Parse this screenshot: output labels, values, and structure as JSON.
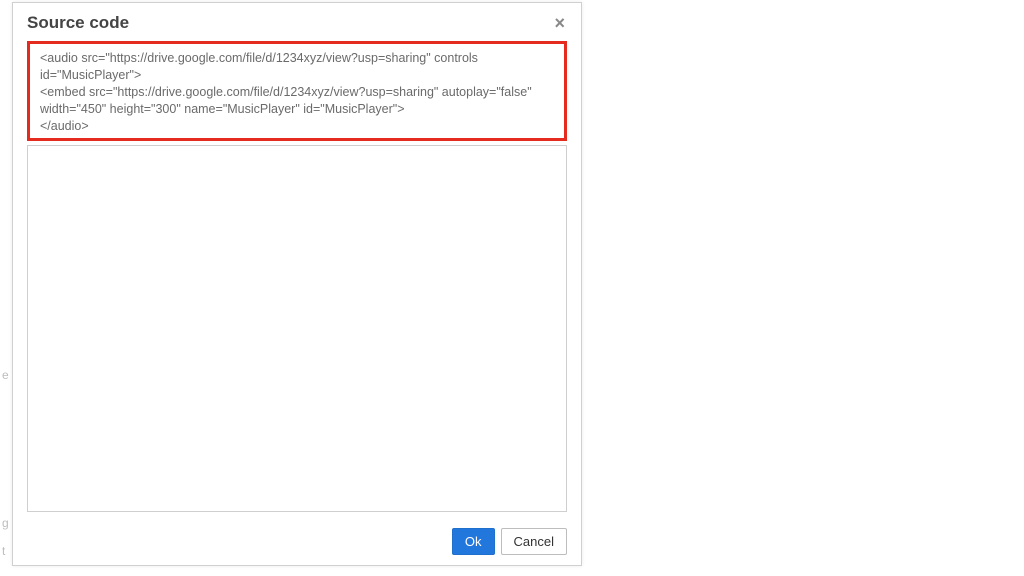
{
  "dialog": {
    "title": "Source code",
    "close_label": "×",
    "code_line1": "<audio src=\"https://drive.google.com/file/d/1234xyz/view?usp=sharing\" controls id=\"MusicPlayer\">",
    "code_line2": "<embed src=\"https://drive.google.com/file/d/1234xyz/view?usp=sharing\" autoplay=\"false\" width=\"450\" height=\"300\" name=\"MusicPlayer\" id=\"MusicPlayer\">",
    "code_line3": "</audio>",
    "ok_label": "Ok",
    "cancel_label": "Cancel"
  },
  "bg": {
    "a": "e",
    "b": "g",
    "c": "t"
  }
}
